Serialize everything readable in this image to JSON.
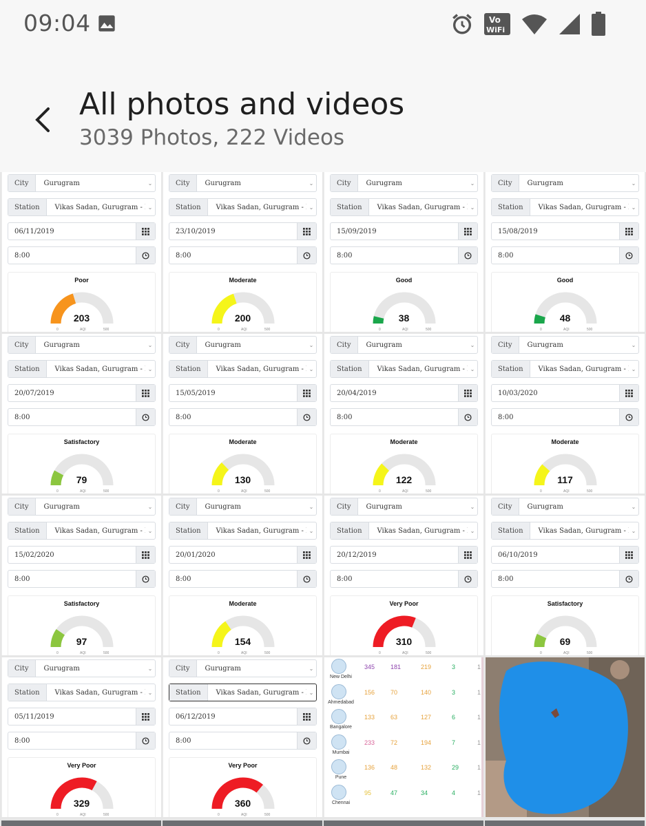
{
  "status": {
    "time": "09:04",
    "icons": [
      "photo-icon",
      "alarm-icon",
      "vowifi-icon",
      "wifi-icon",
      "signal-icon",
      "battery-icon"
    ],
    "vowifi_top": "Vo",
    "vowifi_bottom": "WiFi"
  },
  "header": {
    "title": "All photos and videos",
    "subtitle": "3039 Photos, 222 Videos"
  },
  "form": {
    "city_label": "City",
    "station_label": "Station",
    "city_value": "Gurugram",
    "station_value": "Vikas Sadan, Gurugram - HSPCB",
    "time_value": "8:00",
    "aqi_unit": "AQI",
    "aqi_min": "0",
    "aqi_max": "500"
  },
  "colors": {
    "good": "#1aa64b",
    "satisfactory": "#8cc63f",
    "moderate": "#f5f51a",
    "poor": "#f7941d",
    "very_poor": "#ee1c24",
    "track": "#e6e6e6"
  },
  "tiles": [
    {
      "date": "06/11/2019",
      "category": "Poor",
      "aqi": 203,
      "color": "#f7941d"
    },
    {
      "date": "23/10/2019",
      "category": "Moderate",
      "aqi": 200,
      "color": "#f5f51a"
    },
    {
      "date": "15/09/2019",
      "category": "Good",
      "aqi": 38,
      "color": "#1aa64b"
    },
    {
      "date": "15/08/2019",
      "category": "Good",
      "aqi": 48,
      "color": "#1aa64b"
    },
    {
      "date": "20/07/2019",
      "category": "Satisfactory",
      "aqi": 79,
      "color": "#8cc63f"
    },
    {
      "date": "15/05/2019",
      "category": "Moderate",
      "aqi": 130,
      "color": "#f5f51a"
    },
    {
      "date": "20/04/2019",
      "category": "Moderate",
      "aqi": 122,
      "color": "#f5f51a"
    },
    {
      "date": "10/03/2020",
      "category": "Moderate",
      "aqi": 117,
      "color": "#f5f51a"
    },
    {
      "date": "15/02/2020",
      "category": "Satisfactory",
      "aqi": 97,
      "color": "#8cc63f"
    },
    {
      "date": "20/01/2020",
      "category": "Moderate",
      "aqi": 154,
      "color": "#f5f51a"
    },
    {
      "date": "20/12/2019",
      "category": "Very Poor",
      "aqi": 310,
      "color": "#ee1c24"
    },
    {
      "date": "06/10/2019",
      "category": "Satisfactory",
      "aqi": 69,
      "color": "#8cc63f"
    },
    {
      "date": "05/11/2019",
      "category": "Very Poor",
      "aqi": 329,
      "color": "#ee1c24"
    },
    {
      "date": "06/12/2019",
      "category": "Very Poor",
      "aqi": 360,
      "color": "#ee1c24"
    }
  ],
  "city_ranking": [
    {
      "city": "New Delhi",
      "values": [
        "345",
        "181",
        "219",
        "3",
        "1"
      ],
      "colors": [
        "#8e44ad",
        "#8e44ad",
        "#e6a23c",
        "#27ae60",
        "#999"
      ]
    },
    {
      "city": "Ahmedabad",
      "values": [
        "156",
        "70",
        "140",
        "3",
        "1"
      ],
      "colors": [
        "#e6a23c",
        "#e6a23c",
        "#e6a23c",
        "#27ae60",
        "#999"
      ]
    },
    {
      "city": "Bangalore",
      "values": [
        "133",
        "63",
        "127",
        "6",
        "1"
      ],
      "colors": [
        "#e6a23c",
        "#e6a23c",
        "#e6a23c",
        "#27ae60",
        "#999"
      ]
    },
    {
      "city": "Mumbai",
      "values": [
        "233",
        "72",
        "194",
        "7",
        "1"
      ],
      "colors": [
        "#d9669a",
        "#e6a23c",
        "#e6a23c",
        "#27ae60",
        "#999"
      ]
    },
    {
      "city": "Pune",
      "values": [
        "136",
        "48",
        "132",
        "29",
        "1"
      ],
      "colors": [
        "#e6a23c",
        "#e6a23c",
        "#e6a23c",
        "#27ae60",
        "#999"
      ]
    },
    {
      "city": "Chennai",
      "values": [
        "95",
        "47",
        "34",
        "4",
        "1"
      ],
      "colors": [
        "#e6c23c",
        "#27ae60",
        "#27ae60",
        "#27ae60",
        "#999"
      ]
    }
  ]
}
